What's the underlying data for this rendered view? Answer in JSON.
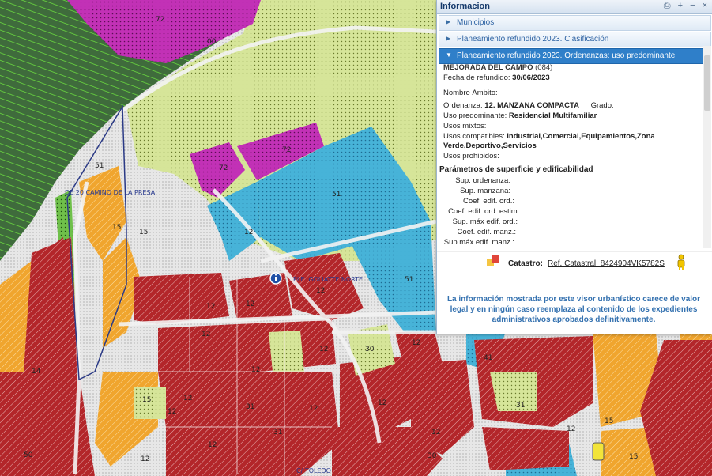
{
  "map": {
    "labels": [
      "72",
      "00",
      "72",
      "72",
      "51",
      "12",
      "51",
      "15",
      "51",
      "15",
      "12",
      "12",
      "12",
      "12",
      "12",
      "12",
      "30",
      "12",
      "31",
      "41",
      "14",
      "12",
      "12",
      "15",
      "12",
      "12",
      "12",
      "12",
      "31",
      "30",
      "15",
      "15",
      "12",
      "31",
      "50",
      "12"
    ],
    "road_labels": [
      "DE 20 CAMINO DE LA PRESA",
      "PLE. GOLIATTE NORTE",
      "C/ TOLEDO"
    ]
  },
  "panel": {
    "title": "Informacion",
    "tools": [
      "print-icon",
      "plus-icon",
      "minus-icon",
      "close-icon"
    ],
    "sections": [
      {
        "label": "Municipios",
        "active": false
      },
      {
        "label": "Planeamiento refundido 2023. Clasificación",
        "active": false
      },
      {
        "label": "Planeamiento refundido 2023. Ordenanzas: uso predominante",
        "active": true
      }
    ],
    "detail": {
      "municipality": "MEJORADA DEL CAMPO",
      "municipality_code": "(084)",
      "fecha_label": "Fecha de refundido:",
      "fecha_value": "30/06/2023",
      "nombre_ambito_label": "Nombre Ámbito:",
      "ordenanza_label": "Ordenanza:",
      "ordenanza_value": "12. MANZANA COMPACTA",
      "grado_label": "Grado:",
      "uso_pred_label": "Uso predominante:",
      "uso_pred_value": "Residencial Multifamiliar",
      "usos_mixtos_label": "Usos mixtos:",
      "usos_compat_label": "Usos compatibles:",
      "usos_compat_value_1": "Industrial,Comercial,Equipamientos,Zona",
      "usos_compat_value_2": "Verde,Deportivo,Servicios",
      "usos_prohib_label": "Usos prohibidos:",
      "params_heading": "Parámetros de superficie y edificabilidad",
      "params": [
        "Sup. ordenanza:",
        "Sup. manzana:",
        "Coef. edif. ord.:",
        "Coef. edif. ord. estim.:",
        "Sup. máx edif. ord.:",
        "Coef. edif. manz.:",
        "Sup.máx edif. manz.:"
      ]
    },
    "catastro_label": "Catastro:",
    "catastro_link": "Ref. Catastral: 8424904VK5782S",
    "disclaimer": "La información mostrada por este visor urbanístico carece de valor legal y en ningún caso reemplaza al contenido de los expedientes administrativos aprobados definitivamente.",
    "colors": {
      "accent": "#2f7fc9",
      "link": "#2e63a3",
      "disclaimer": "#3572b0"
    }
  }
}
